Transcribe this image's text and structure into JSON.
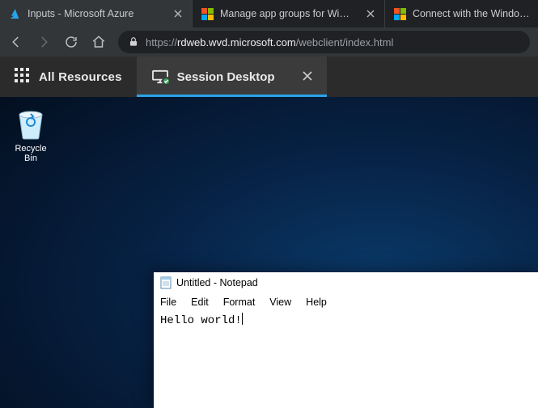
{
  "browser": {
    "tabs": [
      {
        "title": "Inputs - Microsoft Azure"
      },
      {
        "title": "Manage app groups for Window"
      },
      {
        "title": "Connect with the Windows"
      }
    ],
    "url": {
      "scheme": "https://",
      "host": "rdweb.wvd.microsoft.com",
      "path": "/webclient/index.html"
    }
  },
  "toolbar": {
    "all_resources_label": "All Resources",
    "session_tab_label": "Session Desktop"
  },
  "desktop": {
    "recycle_bin_label": "Recycle Bin"
  },
  "notepad": {
    "title": "Untitled - Notepad",
    "menu": {
      "file": "File",
      "edit": "Edit",
      "format": "Format",
      "view": "View",
      "help": "Help"
    },
    "content": "Hello world!"
  }
}
